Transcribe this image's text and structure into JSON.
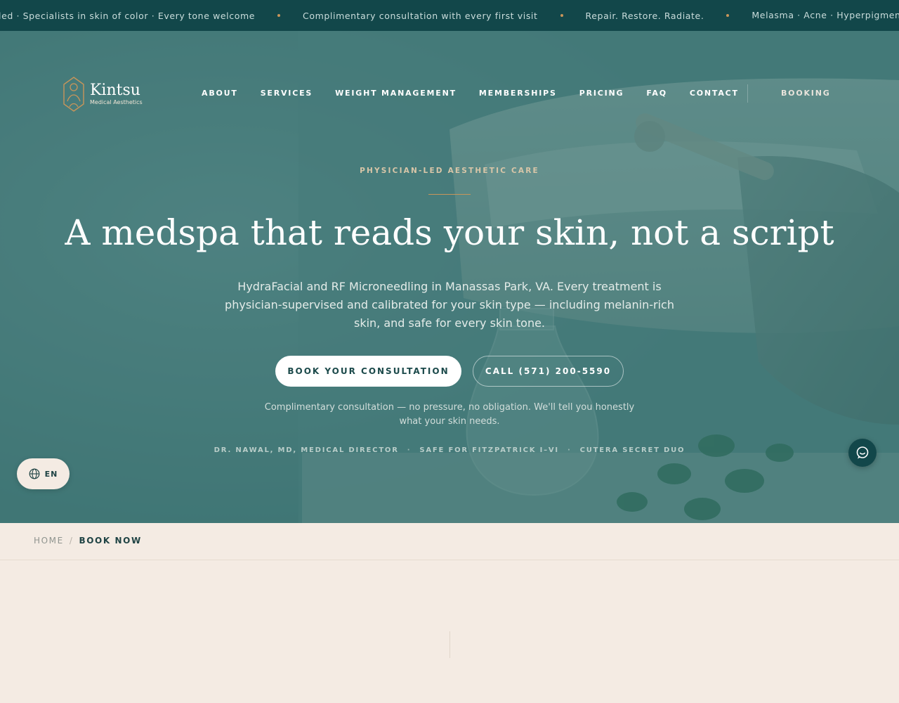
{
  "ticker": {
    "items": [
      "led · Specialists in skin of color · Every tone welcome",
      "Complimentary consultation with every first visit",
      "Repair. Restore. Radiate.",
      "Melasma · Acne · Hyperpigmentation · 🇫🇷 M"
    ]
  },
  "brand": {
    "name": "Kintsu",
    "subtitle": "Medical Aesthetics"
  },
  "nav": {
    "items": [
      "ABOUT",
      "SERVICES",
      "WEIGHT MANAGEMENT",
      "MEMBERSHIPS",
      "PRICING",
      "FAQ",
      "CONTACT"
    ],
    "booking": "BOOKING"
  },
  "hero": {
    "eyebrow": "PHYSICIAN-LED AESTHETIC CARE",
    "headline": "A medspa that reads your skin, not a script",
    "subhead": "HydraFacial and RF Microneedling in Manassas Park, VA. Every treatment is physician-supervised and calibrated for your skin type — including melanin-rich skin, and safe for every skin tone.",
    "cta_primary": "BOOK YOUR CONSULTATION",
    "cta_secondary": "CALL (571) 200-5590",
    "note": "Complimentary consultation — no pressure, no obligation. We'll tell you honestly what your skin needs.",
    "trust": [
      "DR. NAWAL, MD, MEDICAL DIRECTOR",
      "SAFE FOR FITZPATRICK I–VI",
      "CUTERA SECRET DUO"
    ],
    "trust_separator": "·"
  },
  "language": {
    "current": "EN",
    "icon": "globe-icon"
  },
  "chat": {
    "icon": "chat-bubble-icon"
  },
  "breadcrumb": {
    "home": "HOME",
    "separator": "/",
    "current": "BOOK NOW"
  },
  "colors": {
    "ticker_bg": "#12474a",
    "hero_tint": "#3a7373",
    "accent_gold": "#c8955a",
    "cream": "#f4ebe3",
    "dark_teal": "#1f4344"
  }
}
